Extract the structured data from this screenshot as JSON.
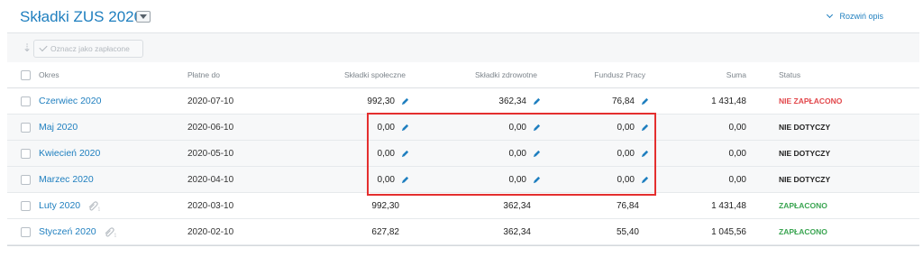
{
  "header": {
    "title": "Składki ZUS 2020",
    "expand_label": "Rozwiń opis"
  },
  "toolbar": {
    "mark_paid_label": "Oznacz jako zapłacone"
  },
  "table": {
    "columns": {
      "okres": "Okres",
      "platne_do": "Płatne do",
      "spoleczne": "Składki społeczne",
      "zdrowotne": "Składki zdrowotne",
      "fundusz": "Fundusz Pracy",
      "suma": "Suma",
      "status": "Status"
    },
    "rows": [
      {
        "okres": "Czerwiec 2020",
        "platne_do": "2020-07-10",
        "spoleczne": "992,30",
        "zdrowotne": "362,34",
        "fundusz": "76,84",
        "suma": "1 431,48",
        "status": "NIE ZAPŁACONO"
      },
      {
        "okres": "Maj 2020",
        "platne_do": "2020-06-10",
        "spoleczne": "0,00",
        "zdrowotne": "0,00",
        "fundusz": "0,00",
        "suma": "0,00",
        "status": "NIE DOTYCZY"
      },
      {
        "okres": "Kwiecień 2020",
        "platne_do": "2020-05-10",
        "spoleczne": "0,00",
        "zdrowotne": "0,00",
        "fundusz": "0,00",
        "suma": "0,00",
        "status": "NIE DOTYCZY"
      },
      {
        "okres": "Marzec 2020",
        "platne_do": "2020-04-10",
        "spoleczne": "0,00",
        "zdrowotne": "0,00",
        "fundusz": "0,00",
        "suma": "0,00",
        "status": "NIE DOTYCZY"
      },
      {
        "okres": "Luty 2020",
        "platne_do": "2020-03-10",
        "spoleczne": "992,30",
        "zdrowotne": "362,34",
        "fundusz": "76,84",
        "suma": "1 431,48",
        "status": "ZAPŁACONO",
        "attachments": "1"
      },
      {
        "okres": "Styczeń 2020",
        "platne_do": "2020-02-10",
        "spoleczne": "627,82",
        "zdrowotne": "362,34",
        "fundusz": "55,40",
        "suma": "1 045,56",
        "status": "ZAPŁACONO",
        "attachments": "1"
      }
    ]
  },
  "colors": {
    "link": "#1f7fbf",
    "status_unpaid": "#e2474b",
    "status_paid": "#3ba552",
    "highlight_border": "#e42f2f"
  },
  "icons": {
    "edit": "pencil-icon",
    "attachment": "paperclip-icon",
    "dropdown": "caret-down-icon",
    "expand": "chevron-down-icon",
    "sort": "sort-icon",
    "mark_paid": "checkmark-icon"
  }
}
